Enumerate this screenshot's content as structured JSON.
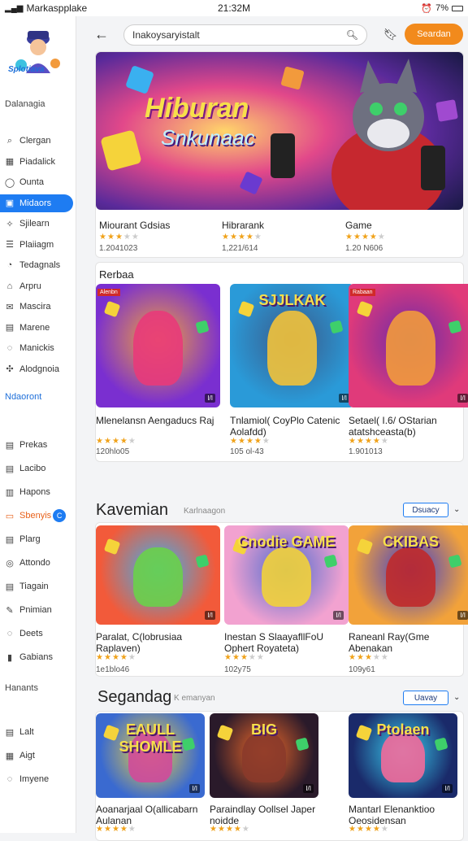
{
  "status": {
    "app_name": "Markaspplake",
    "time": "21:32M",
    "battery": "7%"
  },
  "sidebar": {
    "logo_text": "Splotiava",
    "section1": "Dalanagia",
    "items1": [
      {
        "label": "Clergan",
        "icon": "search-icon"
      },
      {
        "label": "Piadalick",
        "icon": "grid-icon"
      },
      {
        "label": "Ounta",
        "icon": "user-icon"
      },
      {
        "label": "Midaors",
        "icon": "card-icon"
      },
      {
        "label": "Sjilearn",
        "icon": "sparkle-icon"
      },
      {
        "label": "Plaiiagm",
        "icon": "list-icon"
      },
      {
        "label": "Tedagnals",
        "icon": "clock-icon"
      },
      {
        "label": "Arpru",
        "icon": "home-icon"
      },
      {
        "label": "Mascira",
        "icon": "mail-icon"
      },
      {
        "label": "Marene",
        "icon": "doc-icon"
      },
      {
        "label": "Manickis",
        "icon": "chat-icon"
      },
      {
        "label": "Alodgnoia",
        "icon": "puzzle-icon"
      }
    ],
    "section2": "Ndaoront",
    "items2": [
      {
        "label": "Prekas",
        "icon": "doc-icon"
      },
      {
        "label": "Lacibo",
        "icon": "doc-icon"
      },
      {
        "label": "Hapons",
        "icon": "film-icon"
      },
      {
        "label": "Sbenyis",
        "icon": "tv-icon",
        "badge": "C"
      },
      {
        "label": "Plarg",
        "icon": "doc-icon"
      },
      {
        "label": "Attondo",
        "icon": "globe-icon"
      },
      {
        "label": "Tiagain",
        "icon": "doc-icon"
      },
      {
        "label": "Pnimian",
        "icon": "edit-icon"
      },
      {
        "label": "Deets",
        "icon": "chat-icon"
      },
      {
        "label": "Gabians",
        "icon": "bars-icon"
      }
    ],
    "section3": "Hanants",
    "items3": [
      {
        "label": "Lalt",
        "icon": "doc-icon"
      },
      {
        "label": "Aigt",
        "icon": "grid-icon"
      },
      {
        "label": "Imyene",
        "icon": "chat-icon"
      }
    ]
  },
  "topbar": {
    "search_value": "Inakoysaryistalt",
    "signin": "Seardan"
  },
  "hero": {
    "title": "Hiburan",
    "subtitle": "Snkunaac",
    "items": [
      {
        "title": "Miourant Gdsias",
        "rating": 3,
        "sub": "1.2041023"
      },
      {
        "title": "Hibrarank",
        "rating": 4,
        "sub": "1,221/614"
      },
      {
        "title": "Game",
        "rating": 4,
        "sub": "1.20 N606"
      }
    ]
  },
  "section_a": {
    "title": "Rerbaa",
    "items": [
      {
        "title": "Mlenelansn Aengaducs Raj",
        "rating": 4,
        "sub": "120hlo05",
        "badge": "I/I",
        "corner": "Alenbn"
      },
      {
        "title": "Tnlamiol( CoyPlo Catenic Aolafdd)",
        "rating": 4,
        "sub": "105 ol-43",
        "badge": "I/I",
        "banner": "SJJLKAK"
      },
      {
        "title": "Setael( I.6/ OStarian atatshceasta(b)",
        "rating": 4,
        "sub": "1.901013",
        "badge": "I/I",
        "corner": "Rabaan"
      }
    ]
  },
  "section_b": {
    "title": "Kavemian",
    "subtitle": "Karlnaagon",
    "button": "Dsuacy",
    "items": [
      {
        "title": "Paralat, C(lobrusiaa Raplaven)",
        "rating": 4,
        "sub": "1e1blo46",
        "badge": "I/I"
      },
      {
        "title": "Inestan S SlaayafllFoU Ophert Royateta)",
        "rating": 3,
        "sub": "102y75",
        "badge": "I/I",
        "banner": "Cnodie GAME"
      },
      {
        "title": "Raneanl Ray(Gme Abenakan",
        "rating": 3,
        "sub": "109y61",
        "badge": "I/I",
        "banner": "CKIBAS"
      }
    ]
  },
  "section_c": {
    "title": "Segandag",
    "subtitle": "K emanyan",
    "button": "Uavay",
    "items": [
      {
        "title": "Aoanarjaal O(allicabarn Aulanan",
        "rating": 4,
        "sub": "",
        "badge": "I/I",
        "banner": "EAULL SHOMLE"
      },
      {
        "title": "Paraindlay Oollsel Japer noidde",
        "rating": 4,
        "sub": "",
        "badge": "I/I",
        "banner": "BIG"
      },
      {
        "title": "Mantarl Elenanktioo Oeosidensan",
        "rating": 4,
        "sub": "",
        "badge": "I/I",
        "banner": "Ptolaen"
      }
    ]
  },
  "colors": {
    "accent": "#1e7cf2",
    "signin": "#f28a1c",
    "star": "#f0a21a"
  }
}
